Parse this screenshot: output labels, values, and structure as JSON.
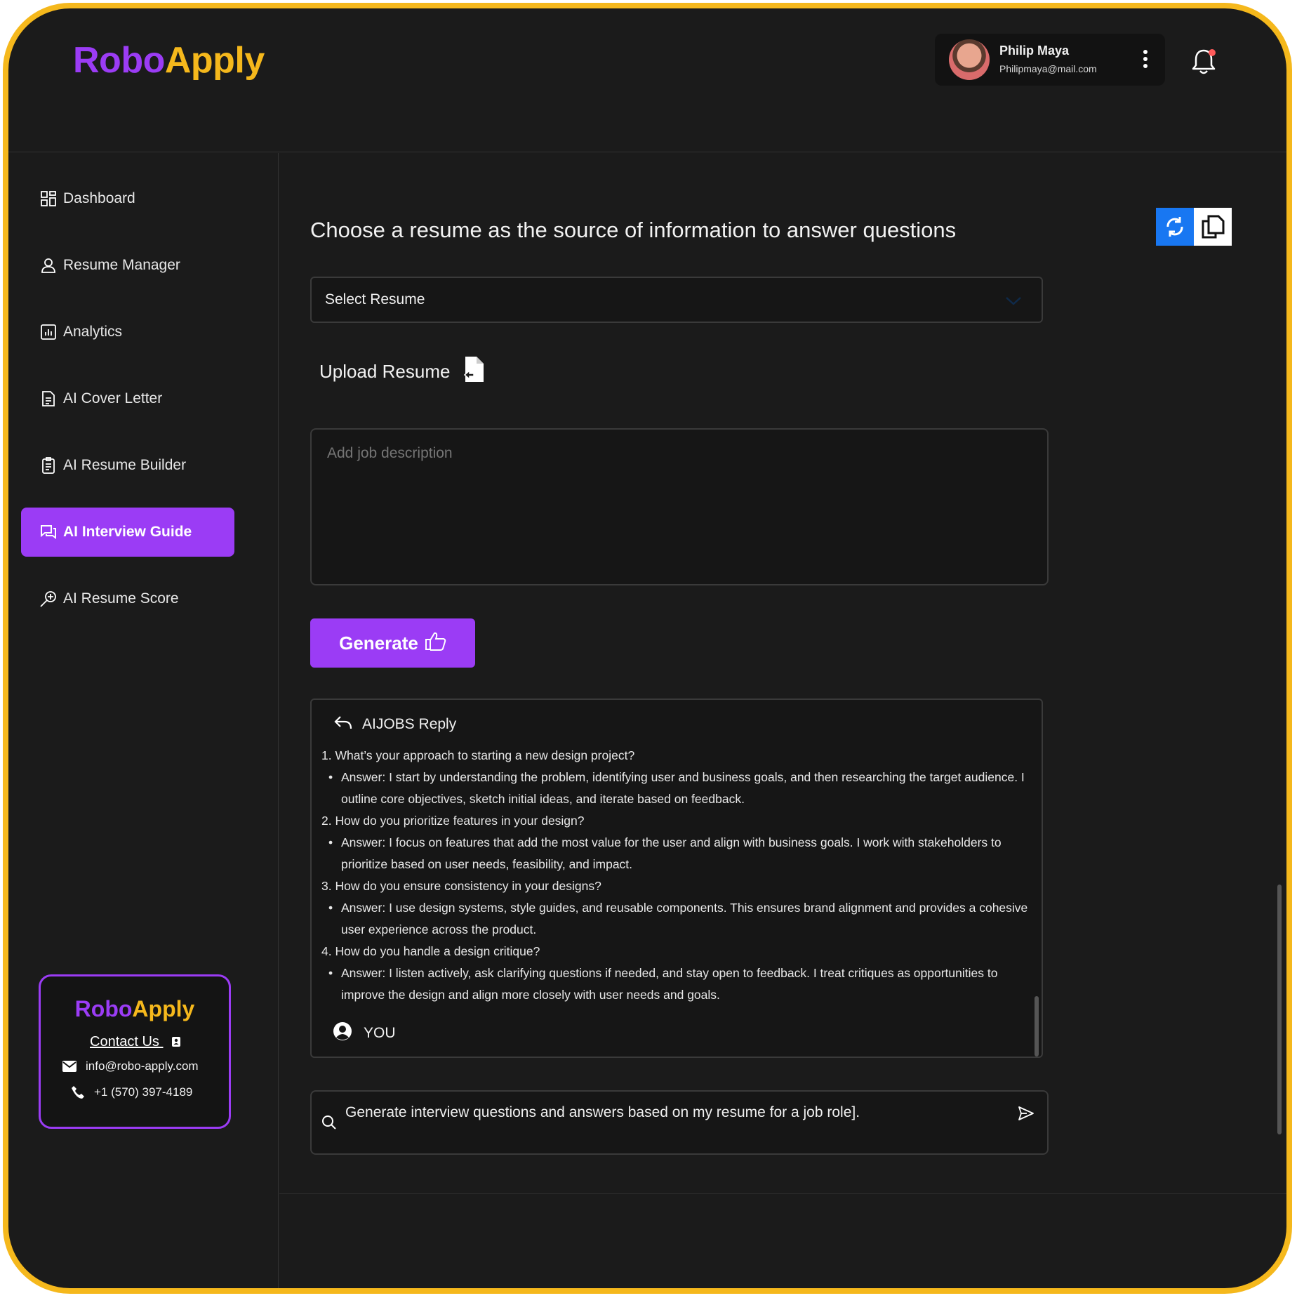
{
  "brand": {
    "part1": "Robo",
    "part2": "Apply",
    "color_purple": "#9b3cf5",
    "color_yellow": "#f5b81c"
  },
  "user": {
    "name": "Philip Maya",
    "email": "Philipmaya@mail.com"
  },
  "sidebar": {
    "items": [
      {
        "label": "Dashboard",
        "icon": "grid-icon"
      },
      {
        "label": "Resume Manager",
        "icon": "user-icon"
      },
      {
        "label": "Analytics",
        "icon": "chart-icon"
      },
      {
        "label": "AI Cover Letter",
        "icon": "document-icon"
      },
      {
        "label": "AI Resume Builder",
        "icon": "clipboard-icon"
      },
      {
        "label": "AI Interview Guide",
        "icon": "chat-icon",
        "active": true
      },
      {
        "label": "AI Resume Score",
        "icon": "magnifier-plus-icon"
      }
    ]
  },
  "contact": {
    "title": "Contact Us",
    "email": "info@robo-apply.com",
    "phone": "+1 (570) 397-4189"
  },
  "main": {
    "title": "Choose a resume as the source of information to answer questions",
    "select_placeholder": "Select Resume",
    "upload_label": "Upload Resume",
    "job_description_placeholder": "Add job description",
    "generate_label": "Generate",
    "reply": {
      "header": "AIJOBS Reply",
      "items": [
        {
          "q": "1. What’s your approach to starting a new design project?",
          "a": "Answer: I start by understanding the problem, identifying user and business goals, and then researching the target audience. I outline core objectives, sketch initial ideas, and iterate based on feedback."
        },
        {
          "q": "2. How do you prioritize features in your design?",
          "a": "Answer: I focus on features that add the most value for the user and align with business goals. I work with stakeholders to prioritize based on user needs, feasibility, and impact."
        },
        {
          "q": "3. How do you ensure consistency in your designs?",
          "a": "Answer: I use design systems, style guides, and reusable components. This ensures brand alignment and provides a cohesive user experience across the product."
        },
        {
          "q": "4. How do you handle a design critique?",
          "a": "Answer: I listen actively, ask clarifying questions if needed, and stay open to feedback. I treat critiques as opportunities to improve the design and align more closely with user needs and goals."
        }
      ],
      "you_label": "YOU"
    },
    "chat_input": "Generate interview questions and answers based on my resume for a job role]."
  }
}
